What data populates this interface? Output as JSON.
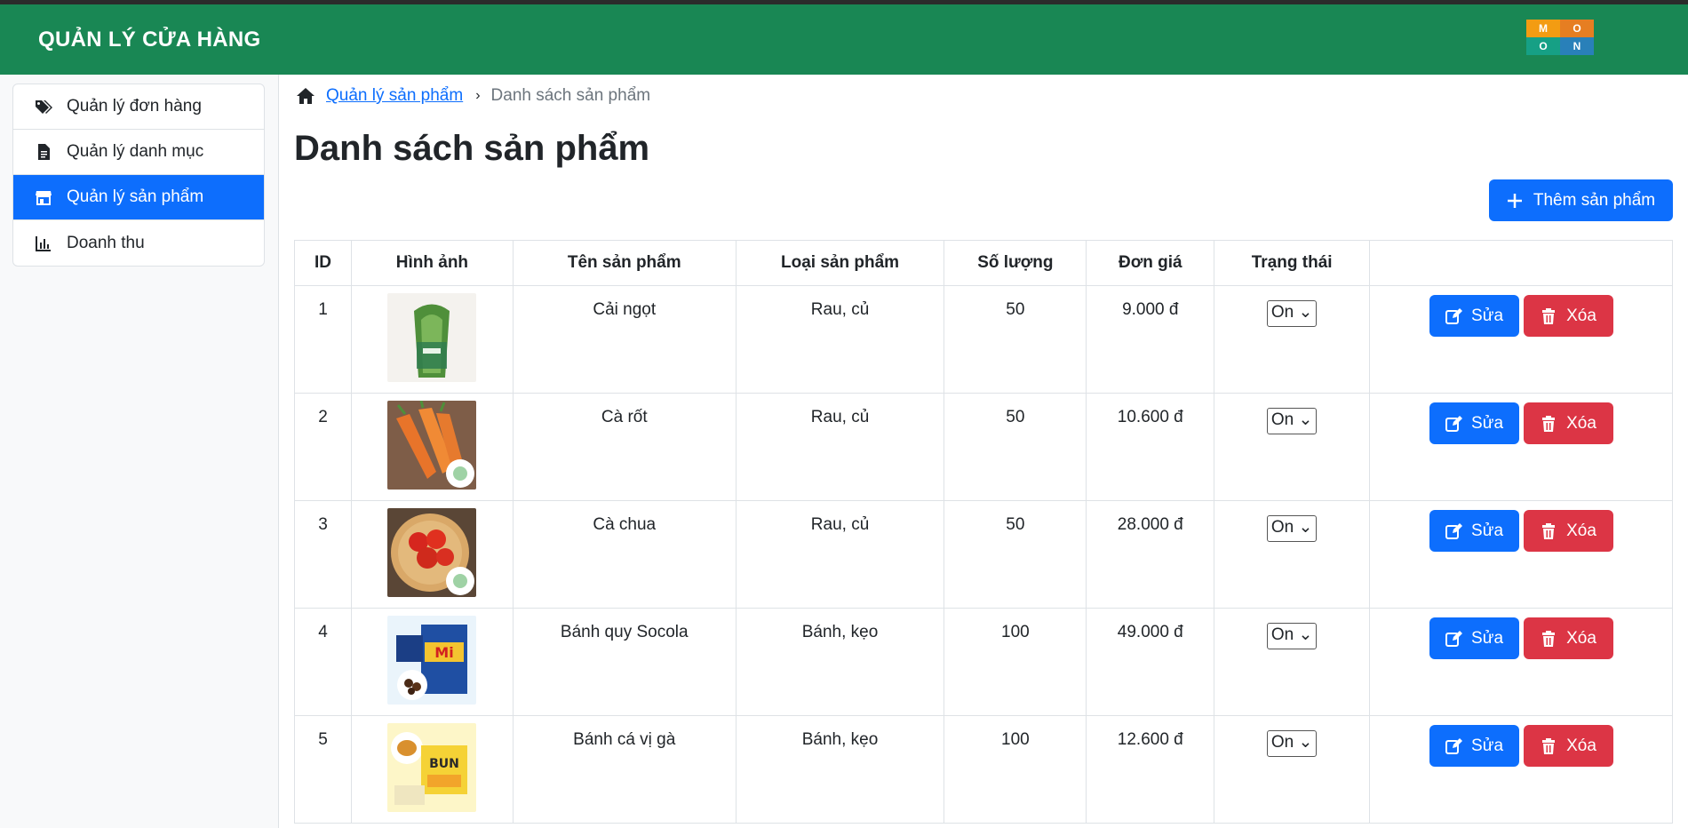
{
  "header": {
    "brand": "QUẢN LÝ CỬA HÀNG",
    "logo_letters": [
      "M",
      "O",
      "O",
      "N"
    ]
  },
  "sidebar": {
    "items": [
      {
        "label": "Quản lý đơn hàng",
        "icon": "tags-icon"
      },
      {
        "label": "Quản lý danh mục",
        "icon": "file-icon"
      },
      {
        "label": "Quản lý sản phẩm",
        "icon": "shop-icon",
        "active": true
      },
      {
        "label": "Doanh thu",
        "icon": "bar-chart-icon"
      }
    ]
  },
  "breadcrumb": {
    "link": "Quản lý sản phẩm",
    "current": "Danh sách sản phẩm"
  },
  "page": {
    "title": "Danh sách sản phẩm",
    "add_button": "Thêm sản phẩm"
  },
  "table": {
    "headers": [
      "ID",
      "Hình ảnh",
      "Tên sản phẩm",
      "Loại sản phẩm",
      "Số lượng",
      "Đơn giá",
      "Trạng thái",
      ""
    ],
    "rows": [
      {
        "id": "1",
        "name": "Cải ngọt",
        "category": "Rau, củ",
        "qty": "50",
        "price": "9.000 đ",
        "status": "On",
        "image": "bok-choy"
      },
      {
        "id": "2",
        "name": "Cà rốt",
        "category": "Rau, củ",
        "qty": "50",
        "price": "10.600 đ",
        "status": "On",
        "image": "carrot"
      },
      {
        "id": "3",
        "name": "Cà chua",
        "category": "Rau, củ",
        "qty": "50",
        "price": "28.000 đ",
        "status": "On",
        "image": "tomato"
      },
      {
        "id": "4",
        "name": "Bánh quy Socola",
        "category": "Bánh, kẹo",
        "qty": "100",
        "price": "49.000 đ",
        "status": "On",
        "image": "choco-cookie"
      },
      {
        "id": "5",
        "name": "Bánh cá vị gà",
        "category": "Bánh, kẹo",
        "qty": "100",
        "price": "12.600 đ",
        "status": "On",
        "image": "fish-cake"
      }
    ],
    "edit_label": "Sửa",
    "delete_label": "Xóa"
  },
  "colors": {
    "header": "#198754",
    "primary": "#0d6efd",
    "danger": "#dc3545"
  }
}
